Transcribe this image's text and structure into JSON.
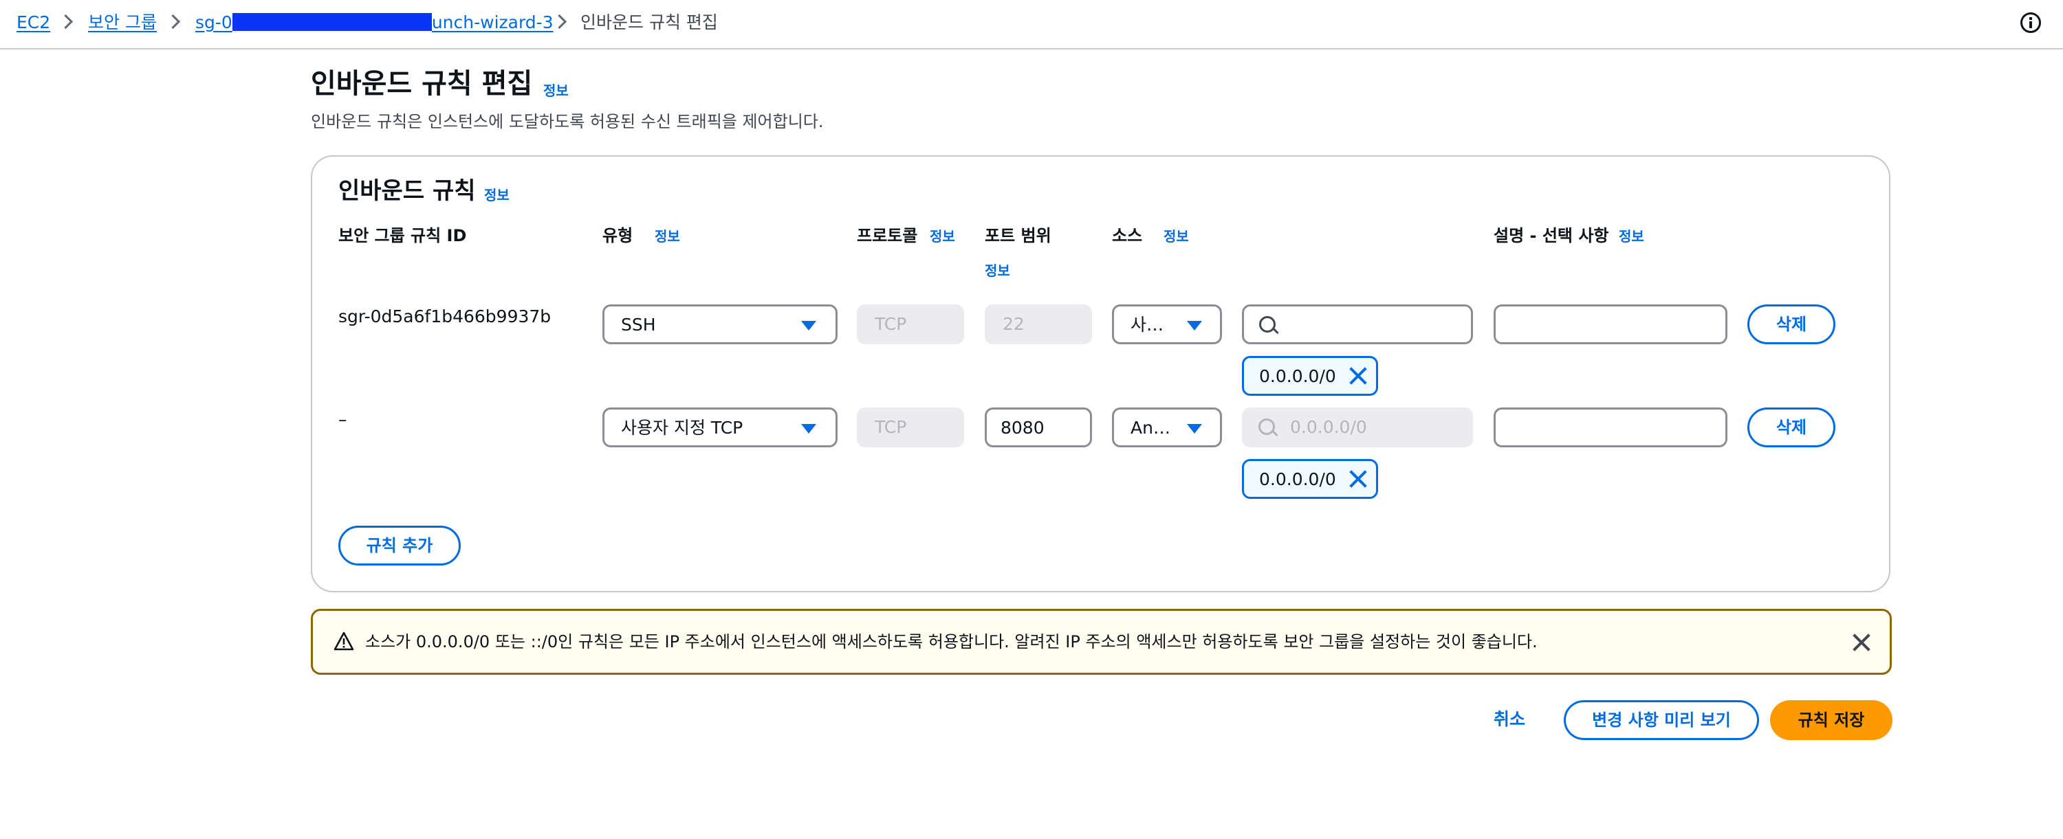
{
  "breadcrumb": {
    "items": [
      "EC2",
      "보안 그룹",
      "sg-0",
      "unch-wizard-3",
      "인바운드 규칙 편집"
    ]
  },
  "page": {
    "title": "인바운드 규칙 편집",
    "info": "정보",
    "description": "인바운드 규칙은 인스턴스에 도달하도록 허용된 수신 트래픽을 제어합니다."
  },
  "rules_panel": {
    "title": "인바운드 규칙",
    "info": "정보",
    "columns": {
      "rule_id": "보안 그룹 규칙 ID",
      "type": "유형",
      "protocol": "프로토콜",
      "port_range": "포트 범위",
      "source": "소스",
      "description": "설명 - 선택 사항",
      "info": "정보"
    },
    "rules": [
      {
        "id": "sgr-0d5a6f1b466b9937b",
        "type": "SSH",
        "protocol": "TCP",
        "port": "22",
        "source_type": "사…",
        "source_search": "",
        "source_placeholder": "",
        "cidr": "0.0.0.0/0",
        "description": "",
        "delete_label": "삭제"
      },
      {
        "id": "–",
        "type": "사용자 지정 TCP",
        "protocol": "TCP",
        "port": "8080",
        "source_type": "An…",
        "source_search": "",
        "source_placeholder": "0.0.0.0/0",
        "cidr": "0.0.0.0/0",
        "description": "",
        "delete_label": "삭제"
      }
    ],
    "add_rule_label": "규칙 추가"
  },
  "alert": {
    "message": "소스가 0.0.0.0/0 또는 ::/0인 규칙은 모든 IP 주소에서 인스턴스에 액세스하도록 허용합니다. 알려진 IP 주소의 액세스만 허용하도록 보안 그룹을 설정하는 것이 좋습니다."
  },
  "footer": {
    "cancel_label": "취소",
    "preview_label": "변경 사항 미리 보기",
    "save_label": "규칙 저장"
  },
  "colors": {
    "link": "#006ce0",
    "primary": "#ff9900",
    "warning_border": "#8d6605",
    "redaction": "#0a35f5"
  }
}
